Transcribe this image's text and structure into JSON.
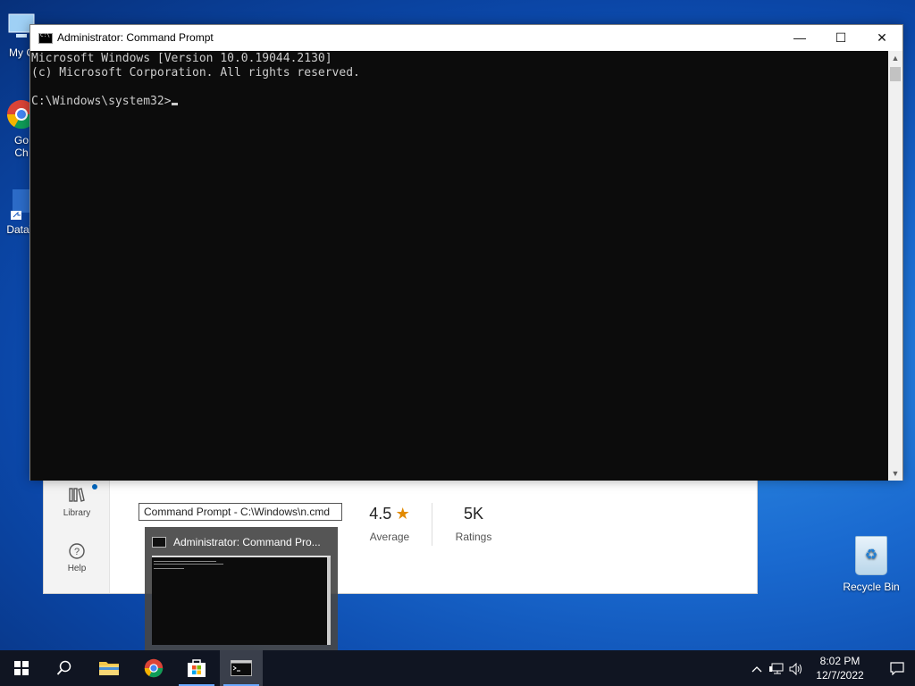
{
  "desktop": {
    "icons": [
      {
        "label": "My C"
      },
      {
        "label": "Go\nCh"
      },
      {
        "label": "DataV"
      }
    ],
    "recycle_bin": {
      "label": "Recycle Bin"
    }
  },
  "store_window": {
    "nav": [
      {
        "label": "Library",
        "icon": "library-icon"
      },
      {
        "label": "Help",
        "icon": "help-icon"
      }
    ],
    "path_text": "Command Prompt - C:\\Windows\\n.cmd",
    "rating_value": "4.5",
    "rating_label": "Average",
    "ratings_count": "5K",
    "ratings_label": "Ratings"
  },
  "cmd_window": {
    "title": "Administrator: Command Prompt",
    "lines": [
      "Microsoft Windows [Version 10.0.19044.2130]",
      "(c) Microsoft Corporation. All rights reserved.",
      "",
      "C:\\Windows\\system32>"
    ],
    "controls": {
      "minimize": "—",
      "maximize": "☐",
      "close": "✕"
    }
  },
  "thumbnail": {
    "title": "Administrator: Command Pro..."
  },
  "taskbar": {
    "items": [
      "start",
      "search",
      "file-explorer",
      "chrome",
      "store",
      "command-prompt"
    ],
    "clock_time": "8:02 PM",
    "clock_date": "12/7/2022"
  },
  "colors": {
    "console_bg": "#0c0c0c",
    "console_fg": "#cccccc",
    "accent": "#0067c0",
    "star": "#e28a00"
  }
}
